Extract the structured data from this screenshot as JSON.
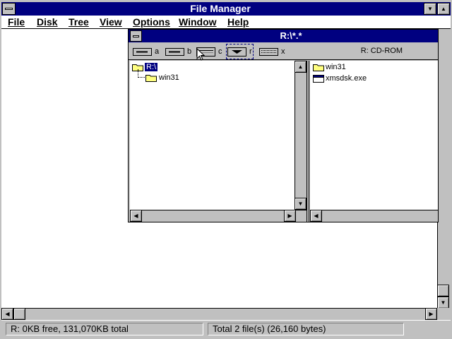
{
  "app": {
    "title": "File Manager"
  },
  "menubar": {
    "items": [
      "File",
      "Disk",
      "Tree",
      "View",
      "Options",
      "Window",
      "Help"
    ]
  },
  "child_window": {
    "title": "R:\\*.*",
    "drives": [
      {
        "letter": "a",
        "type": "floppy-drive-icon"
      },
      {
        "letter": "b",
        "type": "floppy-drive-icon"
      },
      {
        "letter": "c",
        "type": "hard-drive-icon"
      },
      {
        "letter": "r",
        "type": "cdrom-drive-icon",
        "selected": true
      },
      {
        "letter": "x",
        "type": "network-drive-icon"
      }
    ],
    "volume_label": "R: CD-ROM",
    "tree": {
      "root": "R:\\",
      "children": [
        "win31"
      ]
    },
    "files": [
      {
        "name": "win31",
        "type": "folder-icon"
      },
      {
        "name": "xmsdsk.exe",
        "type": "program-icon"
      }
    ]
  },
  "status": {
    "left": "R: 0KB free,  131,070KB total",
    "right": "Total 2 file(s) (26,160 bytes)"
  },
  "colors": {
    "titlebar": "#000080",
    "chrome": "#c0c0c0",
    "folder": "#ffff80"
  }
}
